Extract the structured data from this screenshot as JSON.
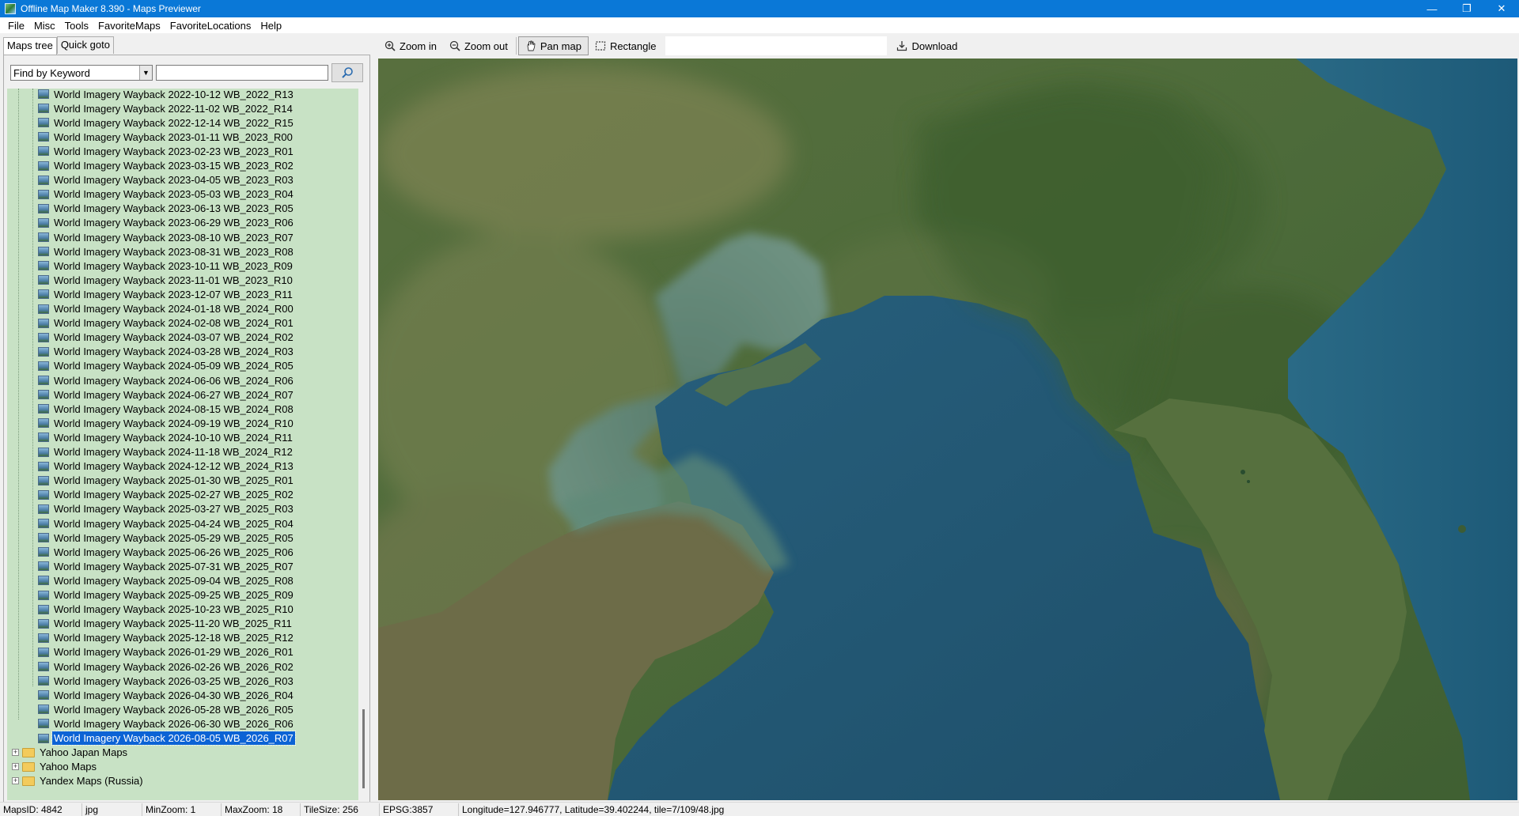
{
  "window": {
    "title": "Offline Map Maker 8.390 - Maps Previewer",
    "controls": [
      "minimize",
      "restore",
      "close"
    ]
  },
  "menu": [
    "File",
    "Misc",
    "Tools",
    "FavoriteMaps",
    "FavoriteLocations",
    "Help"
  ],
  "left_panel": {
    "tabs": [
      "Maps tree",
      "Quick goto"
    ],
    "active_tab": "Maps tree",
    "find_mode": "Find by Keyword",
    "search_value": "",
    "tree_items": [
      "World Imagery Wayback 2022-10-12 WB_2022_R13",
      "World Imagery Wayback 2022-11-02 WB_2022_R14",
      "World Imagery Wayback 2022-12-14 WB_2022_R15",
      "World Imagery Wayback 2023-01-11 WB_2023_R00",
      "World Imagery Wayback 2023-02-23 WB_2023_R01",
      "World Imagery Wayback 2023-03-15 WB_2023_R02",
      "World Imagery Wayback 2023-04-05 WB_2023_R03",
      "World Imagery Wayback 2023-05-03 WB_2023_R04",
      "World Imagery Wayback 2023-06-13 WB_2023_R05",
      "World Imagery Wayback 2023-06-29 WB_2023_R06",
      "World Imagery Wayback 2023-08-10 WB_2023_R07",
      "World Imagery Wayback 2023-08-31 WB_2023_R08",
      "World Imagery Wayback 2023-10-11 WB_2023_R09",
      "World Imagery Wayback 2023-11-01 WB_2023_R10",
      "World Imagery Wayback 2023-12-07 WB_2023_R11",
      "World Imagery Wayback 2024-01-18 WB_2024_R00",
      "World Imagery Wayback 2024-02-08 WB_2024_R01",
      "World Imagery Wayback 2024-03-07 WB_2024_R02",
      "World Imagery Wayback 2024-03-28 WB_2024_R03",
      "World Imagery Wayback 2024-05-09 WB_2024_R05",
      "World Imagery Wayback 2024-06-06 WB_2024_R06",
      "World Imagery Wayback 2024-06-27 WB_2024_R07",
      "World Imagery Wayback 2024-08-15 WB_2024_R08",
      "World Imagery Wayback 2024-09-19 WB_2024_R10",
      "World Imagery Wayback 2024-10-10 WB_2024_R11",
      "World Imagery Wayback 2024-11-18 WB_2024_R12",
      "World Imagery Wayback 2024-12-12 WB_2024_R13",
      "World Imagery Wayback 2025-01-30 WB_2025_R01",
      "World Imagery Wayback 2025-02-27 WB_2025_R02",
      "World Imagery Wayback 2025-03-27 WB_2025_R03",
      "World Imagery Wayback 2025-04-24 WB_2025_R04",
      "World Imagery Wayback 2025-05-29 WB_2025_R05",
      "World Imagery Wayback 2025-06-26 WB_2025_R06",
      "World Imagery Wayback 2025-07-31 WB_2025_R07",
      "World Imagery Wayback 2025-09-04 WB_2025_R08",
      "World Imagery Wayback 2025-09-25 WB_2025_R09",
      "World Imagery Wayback 2025-10-23 WB_2025_R10",
      "World Imagery Wayback 2025-11-20 WB_2025_R11",
      "World Imagery Wayback 2025-12-18 WB_2025_R12",
      "World Imagery Wayback 2026-01-29 WB_2026_R01",
      "World Imagery Wayback 2026-02-26 WB_2026_R02",
      "World Imagery Wayback 2026-03-25 WB_2026_R03",
      "World Imagery Wayback 2026-04-30 WB_2026_R04",
      "World Imagery Wayback 2026-05-28 WB_2026_R05",
      "World Imagery Wayback 2026-06-30 WB_2026_R06",
      "World Imagery Wayback 2026-08-05 WB_2026_R07"
    ],
    "selected_item": "World Imagery Wayback 2026-08-05 WB_2026_R07",
    "folders": [
      "Yahoo Japan Maps",
      "Yahoo Maps",
      "Yandex Maps (Russia)"
    ]
  },
  "toolbar": {
    "zoom_in": "Zoom in",
    "zoom_out": "Zoom out",
    "pan_map": "Pan map",
    "rectangle": "Rectangle",
    "download": "Download",
    "active_tool": "Pan map"
  },
  "status": {
    "maps_id": "MapsID: 4842",
    "format": "jpg",
    "min_zoom": "MinZoom: 1",
    "max_zoom": "MaxZoom: 18",
    "tile_size": "TileSize: 256",
    "epsg": "EPSG:3857",
    "position": "Longitude=127.946777, Latitude=39.402244, tile=7/109/48.jpg"
  },
  "colors": {
    "titlebar": "#0a78d7",
    "tree_bg": "#c8e2c5",
    "selection": "#0c63d5",
    "sea_deep": "#1f5674",
    "sea_shallow": "#4f8a7a",
    "land": "#4f6e3a"
  }
}
